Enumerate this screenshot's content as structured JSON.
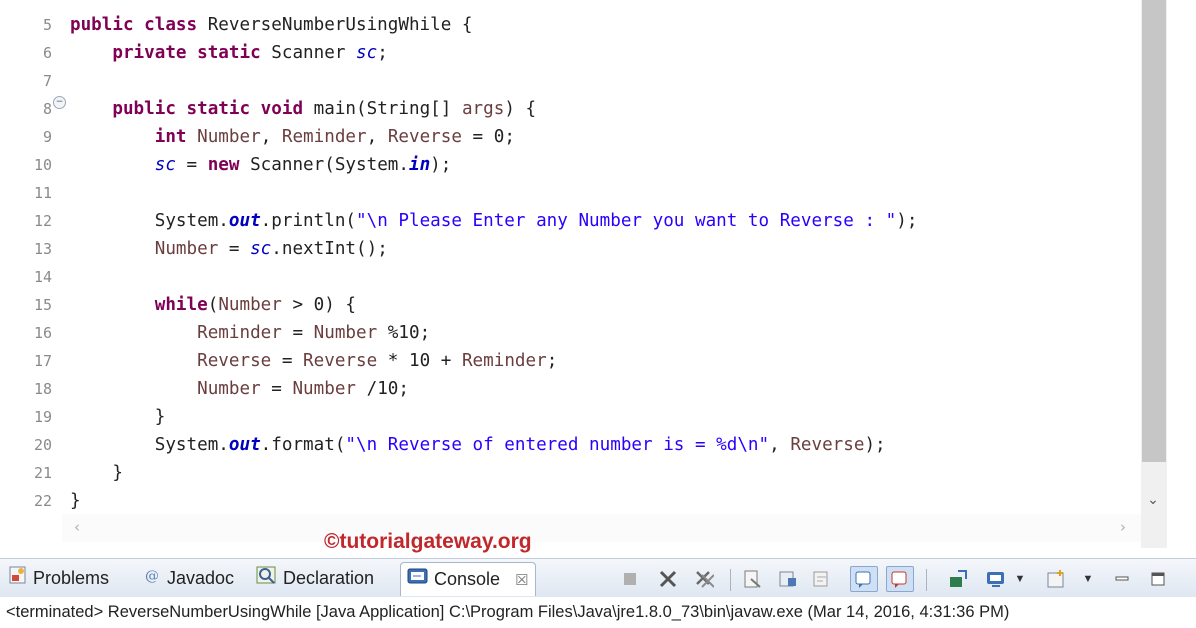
{
  "editor": {
    "lines": [
      {
        "num": "5",
        "parts": [
          {
            "t": "public class ",
            "c": "kw"
          },
          {
            "t": "ReverseNumberUsingWhile {",
            "c": ""
          }
        ]
      },
      {
        "num": "6",
        "parts": [
          {
            "t": "    ",
            "c": ""
          },
          {
            "t": "private static ",
            "c": "kw"
          },
          {
            "t": "Scanner ",
            "c": ""
          },
          {
            "t": "sc",
            "c": "fld"
          },
          {
            "t": ";",
            "c": ""
          }
        ]
      },
      {
        "num": "7",
        "parts": []
      },
      {
        "num": "8",
        "parts": [
          {
            "t": "    ",
            "c": ""
          },
          {
            "t": "public static void ",
            "c": "kw"
          },
          {
            "t": "main(String[] ",
            "c": ""
          },
          {
            "t": "args",
            "c": "var"
          },
          {
            "t": ") {",
            "c": ""
          }
        ]
      },
      {
        "num": "9",
        "parts": [
          {
            "t": "        ",
            "c": ""
          },
          {
            "t": "int ",
            "c": "kw"
          },
          {
            "t": "Number",
            "c": "var"
          },
          {
            "t": ", ",
            "c": ""
          },
          {
            "t": "Reminder",
            "c": "var"
          },
          {
            "t": ", ",
            "c": ""
          },
          {
            "t": "Reverse",
            "c": "var"
          },
          {
            "t": " = 0;",
            "c": ""
          }
        ]
      },
      {
        "num": "10",
        "parts": [
          {
            "t": "        ",
            "c": ""
          },
          {
            "t": "sc",
            "c": "fld"
          },
          {
            "t": " = ",
            "c": ""
          },
          {
            "t": "new ",
            "c": "kw"
          },
          {
            "t": "Scanner(System.",
            "c": ""
          },
          {
            "t": "in",
            "c": "fld2"
          },
          {
            "t": ");",
            "c": ""
          }
        ]
      },
      {
        "num": "11",
        "parts": []
      },
      {
        "num": "12",
        "parts": [
          {
            "t": "        System.",
            "c": ""
          },
          {
            "t": "out",
            "c": "fld2"
          },
          {
            "t": ".println(",
            "c": ""
          },
          {
            "t": "\"\\n Please Enter any Number you want to Reverse : \"",
            "c": "str"
          },
          {
            "t": ");",
            "c": ""
          }
        ]
      },
      {
        "num": "13",
        "parts": [
          {
            "t": "        ",
            "c": ""
          },
          {
            "t": "Number",
            "c": "var"
          },
          {
            "t": " = ",
            "c": ""
          },
          {
            "t": "sc",
            "c": "fld"
          },
          {
            "t": ".nextInt();",
            "c": ""
          }
        ]
      },
      {
        "num": "14",
        "parts": []
      },
      {
        "num": "15",
        "parts": [
          {
            "t": "        ",
            "c": ""
          },
          {
            "t": "while",
            "c": "kw"
          },
          {
            "t": "(",
            "c": ""
          },
          {
            "t": "Number",
            "c": "var"
          },
          {
            "t": " > 0) {",
            "c": ""
          }
        ]
      },
      {
        "num": "16",
        "parts": [
          {
            "t": "            ",
            "c": ""
          },
          {
            "t": "Reminder",
            "c": "var"
          },
          {
            "t": " = ",
            "c": ""
          },
          {
            "t": "Number",
            "c": "var"
          },
          {
            "t": " %10;",
            "c": ""
          }
        ]
      },
      {
        "num": "17",
        "parts": [
          {
            "t": "            ",
            "c": ""
          },
          {
            "t": "Reverse",
            "c": "var"
          },
          {
            "t": " = ",
            "c": ""
          },
          {
            "t": "Reverse",
            "c": "var"
          },
          {
            "t": " * 10 + ",
            "c": ""
          },
          {
            "t": "Reminder",
            "c": "var"
          },
          {
            "t": ";",
            "c": ""
          }
        ]
      },
      {
        "num": "18",
        "parts": [
          {
            "t": "            ",
            "c": ""
          },
          {
            "t": "Number",
            "c": "var"
          },
          {
            "t": " = ",
            "c": ""
          },
          {
            "t": "Number",
            "c": "var"
          },
          {
            "t": " /10;",
            "c": ""
          }
        ]
      },
      {
        "num": "19",
        "parts": [
          {
            "t": "        }",
            "c": ""
          }
        ]
      },
      {
        "num": "20",
        "parts": [
          {
            "t": "        System.",
            "c": ""
          },
          {
            "t": "out",
            "c": "fld2"
          },
          {
            "t": ".format(",
            "c": ""
          },
          {
            "t": "\"\\n Reverse of entered number is = %d\\n\"",
            "c": "str"
          },
          {
            "t": ", ",
            "c": ""
          },
          {
            "t": "Reverse",
            "c": "var"
          },
          {
            "t": ");",
            "c": ""
          }
        ]
      },
      {
        "num": "21",
        "parts": [
          {
            "t": "    }",
            "c": ""
          }
        ]
      },
      {
        "num": "22",
        "parts": [
          {
            "t": "}",
            "c": ""
          }
        ]
      }
    ]
  },
  "watermark": "©tutorialgateway.org",
  "tabs": {
    "problems": "Problems",
    "javadoc": "Javadoc",
    "declaration": "Declaration",
    "console": "Console",
    "console_close": "☒"
  },
  "toolbar": {
    "icons": [
      "terminate-icon",
      "remove-launch-icon",
      "remove-all-terminated-icon",
      "clear-console-icon",
      "scroll-lock-icon",
      "word-wrap-icon",
      "show-stdout-icon",
      "show-stderr-icon",
      "pin-console-icon",
      "display-console-icon",
      "open-console-icon",
      "minimize-icon",
      "maximize-icon"
    ]
  },
  "console": {
    "status": "<terminated> ReverseNumberUsingWhile [Java Application] C:\\Program Files\\Java\\jre1.8.0_73\\bin\\javaw.exe (Mar 14, 2016, 4:31:36 PM)"
  },
  "colors": {
    "keyword": "#7f0055",
    "string": "#2a00ff",
    "field": "#0000c0",
    "variable": "#6a3e3e",
    "watermark": "#c0282c"
  }
}
